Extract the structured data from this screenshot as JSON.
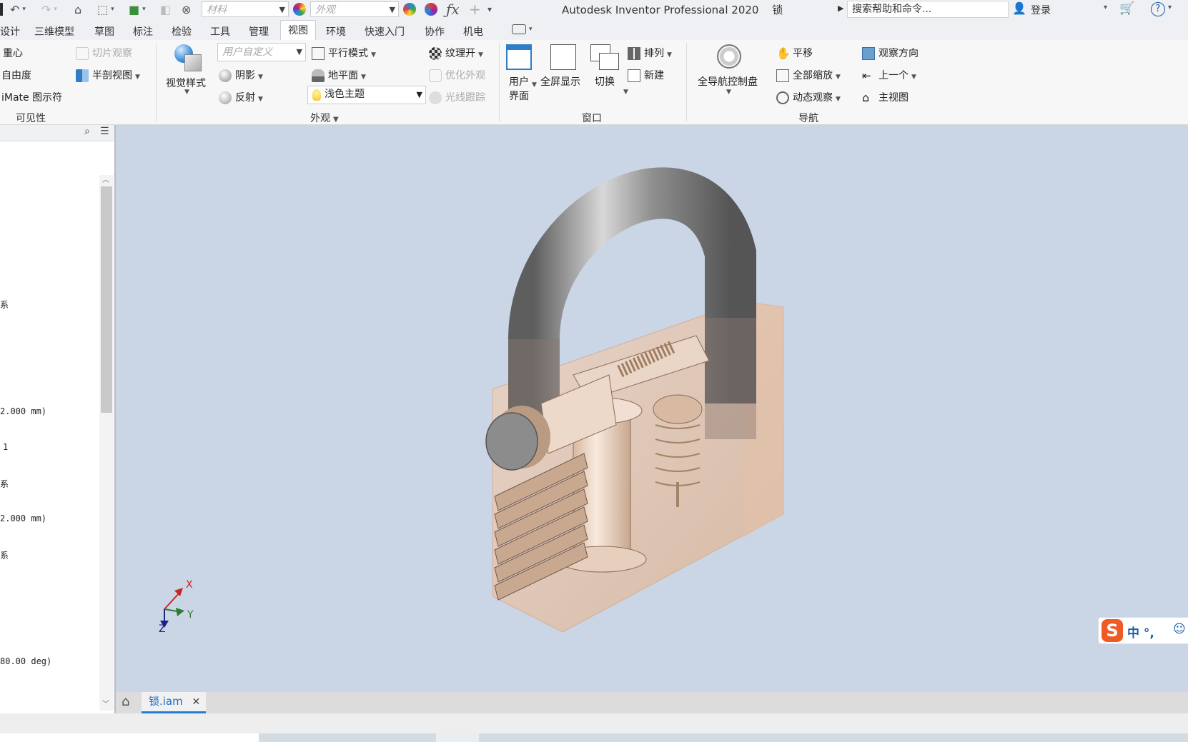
{
  "app": {
    "title": "Autodesk Inventor Professional 2020",
    "document_name": "锁",
    "material_placeholder": "材料",
    "appearance_placeholder": "外观",
    "search_placeholder": "搜索帮助和命令...",
    "login_label": "登录",
    "help_label": "?"
  },
  "menu_tabs": [
    {
      "label": "设计"
    },
    {
      "label": "三维模型"
    },
    {
      "label": "草图"
    },
    {
      "label": "标注"
    },
    {
      "label": "检验"
    },
    {
      "label": "工具"
    },
    {
      "label": "管理"
    },
    {
      "label": "视图"
    },
    {
      "label": "环境"
    },
    {
      "label": "快速入门"
    },
    {
      "label": "协作"
    },
    {
      "label": "机电"
    }
  ],
  "active_tab": "视图",
  "ribbon": {
    "visibility": {
      "center_of_gravity": "重心",
      "degrees_of_freedom": "自由度",
      "imate_glyph": "iMate 图示符",
      "slice_graphics": "切片观察",
      "half_section": "半剖视图",
      "group_label": "可见性"
    },
    "appearance": {
      "visual_style": "视觉样式",
      "custom_placeholder": "用户自定义",
      "shadows": "阴影",
      "reflections": "反射",
      "parallel_mode": "平行模式",
      "ground_plane": "地平面",
      "light_theme": "浅色主题",
      "textures_on": "纹理开",
      "optimize_appearance": "优化外观",
      "ray_tracing": "光线跟踪",
      "group_label": "外观"
    },
    "window": {
      "user_interface_1": "用户",
      "user_interface_2": "界面",
      "full_screen": "全屏显示",
      "switch": "切换",
      "arrange": "排列",
      "new_window": "新建",
      "group_label": "窗口"
    },
    "navigate": {
      "full_nav_wheel": "全导航控制盘",
      "pan": "平移",
      "zoom_all": "全部缩放",
      "orbit": "动态观察",
      "look_at": "观察方向",
      "previous": "上一个",
      "home_view": "主视图",
      "group_label": "导航"
    }
  },
  "left_panel": {
    "lines": [
      {
        "text": "系"
      },
      {
        "text": "2.000 mm)"
      },
      {
        "text": "1"
      },
      {
        "text": "系"
      },
      {
        "text": "2.000 mm)"
      },
      {
        "text": "系"
      },
      {
        "text": "80.00 deg)"
      }
    ]
  },
  "triad": {
    "x": "X",
    "y": "Y",
    "z": "Z"
  },
  "document_tab": {
    "label": "锁.iam"
  },
  "ime": {
    "label": "中 °,"
  },
  "colors": {
    "viewport_bg": "#cad6e5",
    "accent": "#1f7fd6",
    "lock_body": "#e7c3a9",
    "shackle": "#8c8c8c"
  }
}
